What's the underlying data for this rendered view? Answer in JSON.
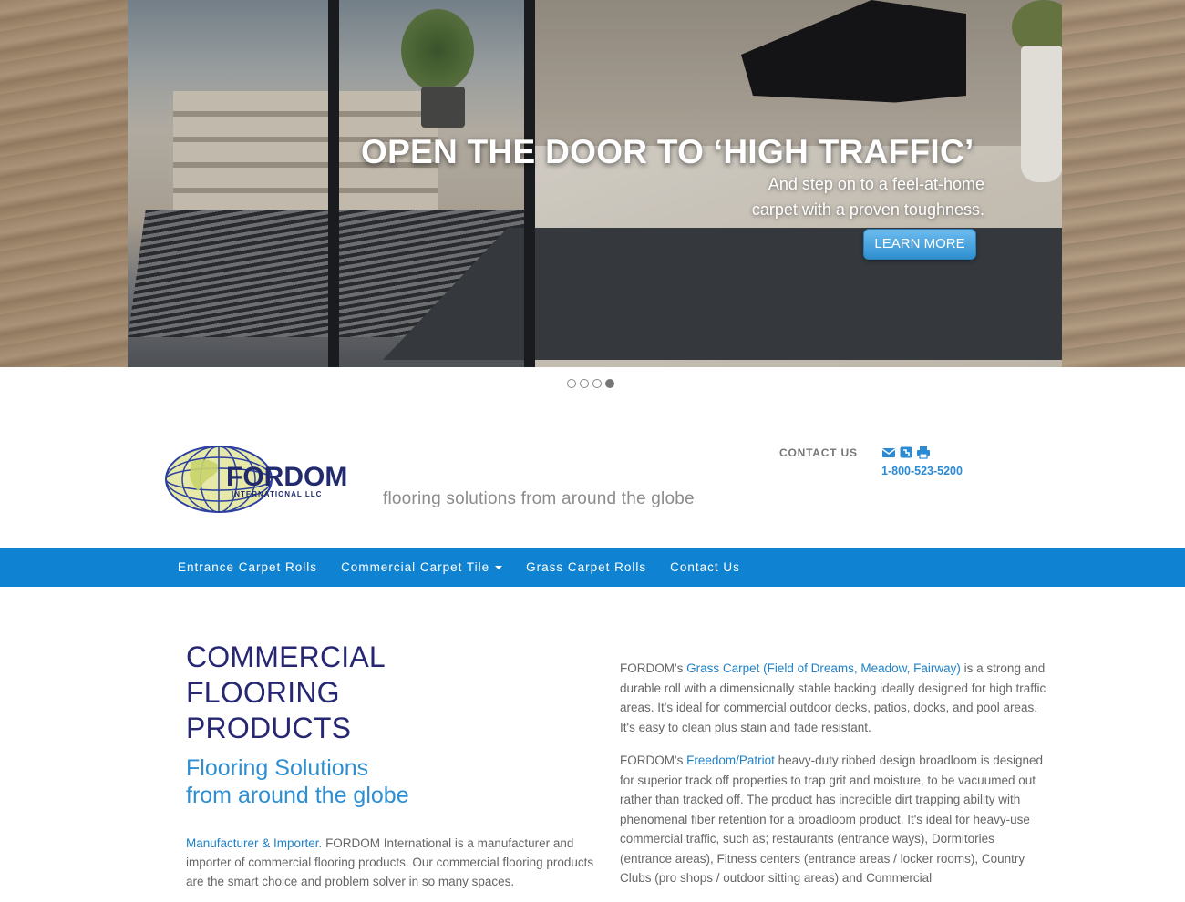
{
  "hero": {
    "title": "OPEN THE DOOR TO ‘HIGH TRAFFIC’",
    "subtitle_line1": "And step on to a feel-at-home",
    "subtitle_line2": "carpet with a proven toughness.",
    "button_label": "LEARN MORE",
    "slides_total": 4,
    "active_slide": 4
  },
  "header": {
    "logo_text": "FORDOM",
    "logo_subtext": "INTERNATIONAL LLC",
    "tagline": "flooring solutions from around the globe",
    "contact_label": "CONTACT US",
    "phone": "1-800-523-5200",
    "icons": [
      "email-icon",
      "fax-icon",
      "print-icon"
    ]
  },
  "nav": {
    "items": [
      {
        "label": "Entrance Carpet Rolls"
      },
      {
        "label": "Commercial Carpet Tile"
      },
      {
        "label": "Grass Carpet Rolls"
      },
      {
        "label": "Contact Us"
      }
    ]
  },
  "main": {
    "heading_line1": "COMMERCIAL",
    "heading_line2": "FLOORING",
    "heading_line3": "PRODUCTS",
    "subheading_line1": "Flooring Solutions",
    "subheading_line2": "from around the globe",
    "intro_link": "Manufacturer & Importer.",
    "intro_text": " FORDOM International is a manufacturer and importer of commercial flooring products. Our commercial flooring products are the smart choice and problem solver in so many spaces.",
    "p1_prefix": "FORDOM's ",
    "p1_link": "Grass Carpet (Field of Dreams, Meadow, Fairway)",
    "p1_text": " is a strong and durable roll with a dimensionally stable backing ideally designed for high traffic areas. It's ideal for commercial outdoor decks, patios, docks, and pool areas. It's easy to clean plus stain and fade resistant.",
    "p2_prefix": "FORDOM's ",
    "p2_link": "Freedom/Patriot",
    "p2_text": " heavy-duty ribbed design broadloom is designed for superior track off properties to trap grit and moisture, to be vacuumed out rather than tracked off. The product has incredible dirt trapping ability with phenomenal fiber retention for a broadloom product. It's ideal for heavy-use commercial traffic, such as; restaurants (entrance ways), Dormitories (entrance areas), Fitness centers (entrance areas / locker rooms), Country Clubs (pro shops / outdoor sitting areas) and Commercial"
  },
  "colors": {
    "nav_bg": "#0f83d2",
    "heading": "#262673",
    "accent": "#2f8fd3"
  }
}
